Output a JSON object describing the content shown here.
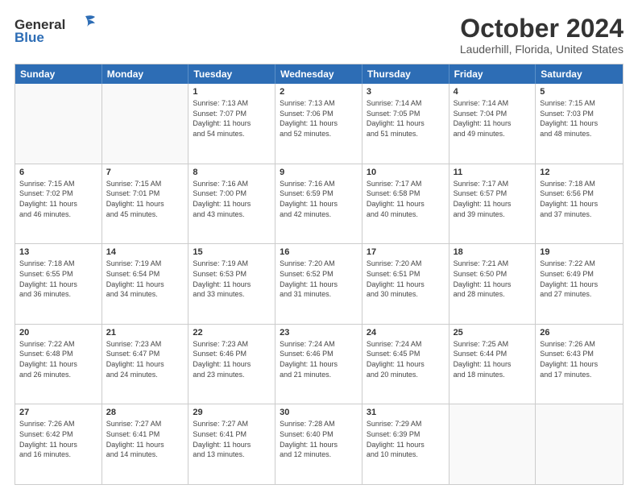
{
  "header": {
    "logo_line1": "General",
    "logo_line2": "Blue",
    "title": "October 2024",
    "subtitle": "Lauderhill, Florida, United States"
  },
  "calendar": {
    "days": [
      "Sunday",
      "Monday",
      "Tuesday",
      "Wednesday",
      "Thursday",
      "Friday",
      "Saturday"
    ],
    "weeks": [
      [
        {
          "num": "",
          "info": ""
        },
        {
          "num": "",
          "info": ""
        },
        {
          "num": "1",
          "info": "Sunrise: 7:13 AM\nSunset: 7:07 PM\nDaylight: 11 hours\nand 54 minutes."
        },
        {
          "num": "2",
          "info": "Sunrise: 7:13 AM\nSunset: 7:06 PM\nDaylight: 11 hours\nand 52 minutes."
        },
        {
          "num": "3",
          "info": "Sunrise: 7:14 AM\nSunset: 7:05 PM\nDaylight: 11 hours\nand 51 minutes."
        },
        {
          "num": "4",
          "info": "Sunrise: 7:14 AM\nSunset: 7:04 PM\nDaylight: 11 hours\nand 49 minutes."
        },
        {
          "num": "5",
          "info": "Sunrise: 7:15 AM\nSunset: 7:03 PM\nDaylight: 11 hours\nand 48 minutes."
        }
      ],
      [
        {
          "num": "6",
          "info": "Sunrise: 7:15 AM\nSunset: 7:02 PM\nDaylight: 11 hours\nand 46 minutes."
        },
        {
          "num": "7",
          "info": "Sunrise: 7:15 AM\nSunset: 7:01 PM\nDaylight: 11 hours\nand 45 minutes."
        },
        {
          "num": "8",
          "info": "Sunrise: 7:16 AM\nSunset: 7:00 PM\nDaylight: 11 hours\nand 43 minutes."
        },
        {
          "num": "9",
          "info": "Sunrise: 7:16 AM\nSunset: 6:59 PM\nDaylight: 11 hours\nand 42 minutes."
        },
        {
          "num": "10",
          "info": "Sunrise: 7:17 AM\nSunset: 6:58 PM\nDaylight: 11 hours\nand 40 minutes."
        },
        {
          "num": "11",
          "info": "Sunrise: 7:17 AM\nSunset: 6:57 PM\nDaylight: 11 hours\nand 39 minutes."
        },
        {
          "num": "12",
          "info": "Sunrise: 7:18 AM\nSunset: 6:56 PM\nDaylight: 11 hours\nand 37 minutes."
        }
      ],
      [
        {
          "num": "13",
          "info": "Sunrise: 7:18 AM\nSunset: 6:55 PM\nDaylight: 11 hours\nand 36 minutes."
        },
        {
          "num": "14",
          "info": "Sunrise: 7:19 AM\nSunset: 6:54 PM\nDaylight: 11 hours\nand 34 minutes."
        },
        {
          "num": "15",
          "info": "Sunrise: 7:19 AM\nSunset: 6:53 PM\nDaylight: 11 hours\nand 33 minutes."
        },
        {
          "num": "16",
          "info": "Sunrise: 7:20 AM\nSunset: 6:52 PM\nDaylight: 11 hours\nand 31 minutes."
        },
        {
          "num": "17",
          "info": "Sunrise: 7:20 AM\nSunset: 6:51 PM\nDaylight: 11 hours\nand 30 minutes."
        },
        {
          "num": "18",
          "info": "Sunrise: 7:21 AM\nSunset: 6:50 PM\nDaylight: 11 hours\nand 28 minutes."
        },
        {
          "num": "19",
          "info": "Sunrise: 7:22 AM\nSunset: 6:49 PM\nDaylight: 11 hours\nand 27 minutes."
        }
      ],
      [
        {
          "num": "20",
          "info": "Sunrise: 7:22 AM\nSunset: 6:48 PM\nDaylight: 11 hours\nand 26 minutes."
        },
        {
          "num": "21",
          "info": "Sunrise: 7:23 AM\nSunset: 6:47 PM\nDaylight: 11 hours\nand 24 minutes."
        },
        {
          "num": "22",
          "info": "Sunrise: 7:23 AM\nSunset: 6:46 PM\nDaylight: 11 hours\nand 23 minutes."
        },
        {
          "num": "23",
          "info": "Sunrise: 7:24 AM\nSunset: 6:46 PM\nDaylight: 11 hours\nand 21 minutes."
        },
        {
          "num": "24",
          "info": "Sunrise: 7:24 AM\nSunset: 6:45 PM\nDaylight: 11 hours\nand 20 minutes."
        },
        {
          "num": "25",
          "info": "Sunrise: 7:25 AM\nSunset: 6:44 PM\nDaylight: 11 hours\nand 18 minutes."
        },
        {
          "num": "26",
          "info": "Sunrise: 7:26 AM\nSunset: 6:43 PM\nDaylight: 11 hours\nand 17 minutes."
        }
      ],
      [
        {
          "num": "27",
          "info": "Sunrise: 7:26 AM\nSunset: 6:42 PM\nDaylight: 11 hours\nand 16 minutes."
        },
        {
          "num": "28",
          "info": "Sunrise: 7:27 AM\nSunset: 6:41 PM\nDaylight: 11 hours\nand 14 minutes."
        },
        {
          "num": "29",
          "info": "Sunrise: 7:27 AM\nSunset: 6:41 PM\nDaylight: 11 hours\nand 13 minutes."
        },
        {
          "num": "30",
          "info": "Sunrise: 7:28 AM\nSunset: 6:40 PM\nDaylight: 11 hours\nand 12 minutes."
        },
        {
          "num": "31",
          "info": "Sunrise: 7:29 AM\nSunset: 6:39 PM\nDaylight: 11 hours\nand 10 minutes."
        },
        {
          "num": "",
          "info": ""
        },
        {
          "num": "",
          "info": ""
        }
      ]
    ]
  }
}
